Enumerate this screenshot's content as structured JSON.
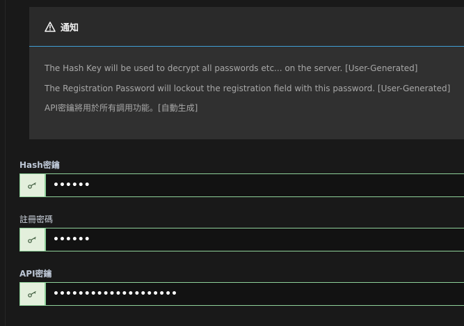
{
  "notice": {
    "icon": "warning-icon",
    "title": "通知",
    "lines": [
      "The Hash Key will be used to decrypt all passwords etc... on the server. [User-Generated]",
      "The Registration Password will lockout the registration field with this password. [User-Generated]",
      "API密鑰將用於所有調用功能。[自動生成]"
    ],
    "accent_color": "#3f9fd6"
  },
  "fields": [
    {
      "label": "Hash密鑰",
      "icon": "key-icon",
      "value": "••••••"
    },
    {
      "label": "註冊密碼",
      "icon": "key-icon",
      "value": "••••••"
    },
    {
      "label": "API密鑰",
      "icon": "key-icon",
      "value": "••••••••••••••••••••"
    }
  ],
  "colors": {
    "input_border": "#8fd19a",
    "addon_bg": "#e3efdc",
    "page_bg": "#191919"
  }
}
